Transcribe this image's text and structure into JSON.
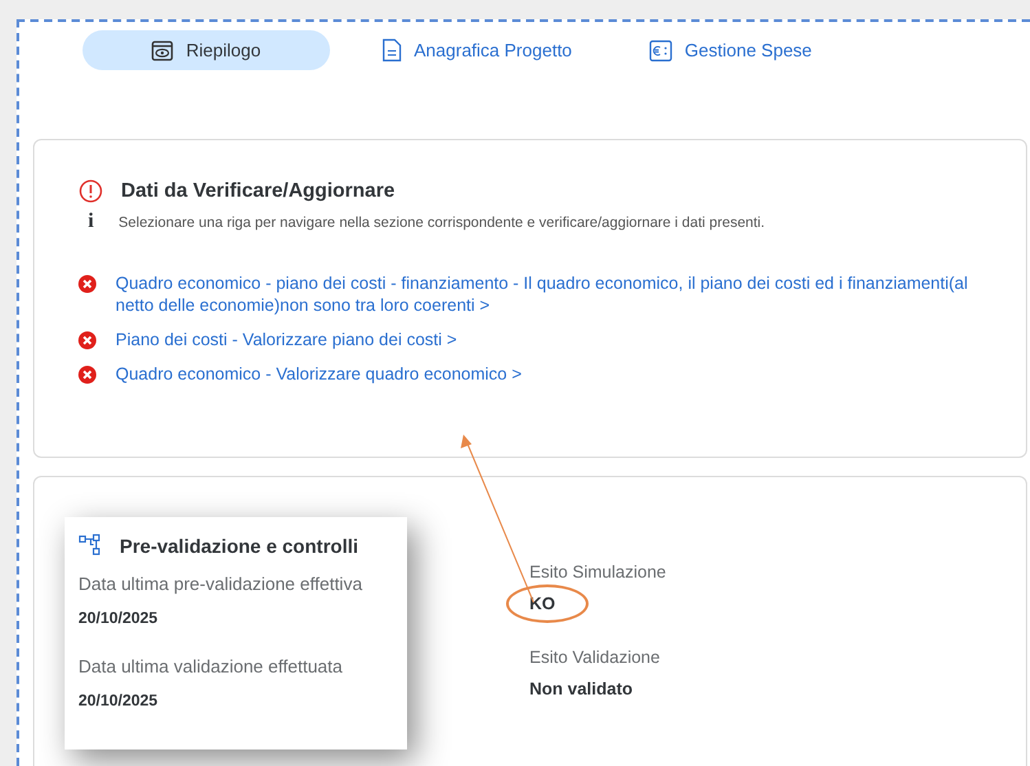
{
  "tabs": [
    {
      "label": "Riepilogo",
      "selected": true
    },
    {
      "label": "Anagrafica Progetto",
      "selected": false
    },
    {
      "label": "Gestione Spese",
      "selected": false
    }
  ],
  "issues_panel": {
    "title": "Dati da Verificare/Aggiornare",
    "info_icon": "i",
    "info": "Selezionare una riga per navigare nella sezione corrispondente e verificare/aggiornare i dati presenti.",
    "issues": [
      {
        "text": "Quadro economico - piano dei costi - finanziamento - Il quadro economico, il piano dei costi ed i finanziamenti(al netto delle economie)non sono tra loro coerenti >"
      },
      {
        "text": "Piano dei costi - Valorizzare piano dei costi >"
      },
      {
        "text": "Quadro economico - Valorizzare quadro economico >"
      }
    ]
  },
  "validation_popup": {
    "title": "Pre-validazione e controlli",
    "fields": [
      {
        "label": "Data ultima pre-validazione effettiva",
        "value": "20/10/2025"
      },
      {
        "label": "Data ultima validazione effettuata",
        "value": "20/10/2025"
      }
    ]
  },
  "results": [
    {
      "label": "Esito Simulazione",
      "value": "KO",
      "highlighted": true
    },
    {
      "label": "Esito Validazione",
      "value": "Non validato",
      "highlighted": false
    }
  ]
}
